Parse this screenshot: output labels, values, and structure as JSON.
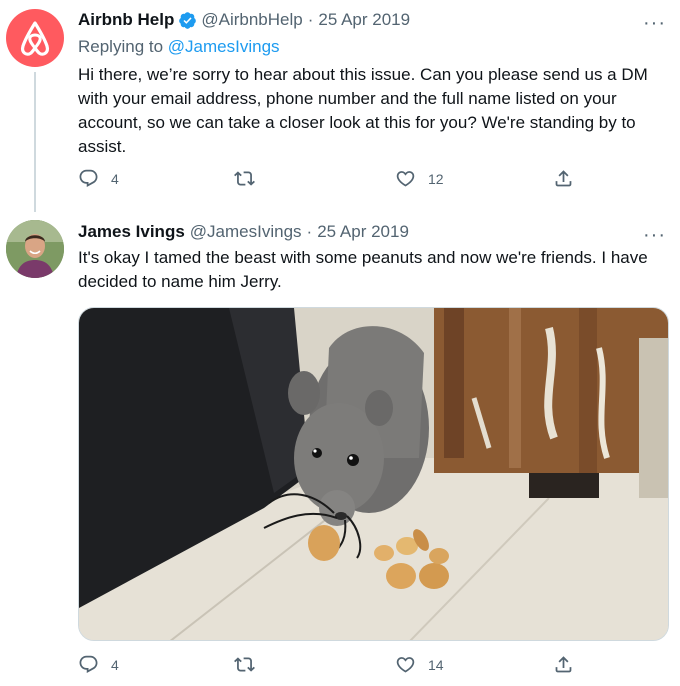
{
  "tweets": [
    {
      "name": "Airbnb Help",
      "handle": "@AirbnbHelp",
      "separator": "·",
      "date": "25 Apr 2019",
      "more": "···",
      "replying_label": "Replying to",
      "replying_handle": "@JamesIvings",
      "text": "Hi there, we’re sorry to hear about this issue. Can you please send us a DM with your email address, phone number and the full name listed on your account, so we can take a closer look at this for you? We're standing by to assist.",
      "replies": "4",
      "retweets": "",
      "likes": "12",
      "verified": true,
      "brand_color": "#ff5a5f"
    },
    {
      "name": "James Ivings",
      "handle": "@JamesIvings",
      "separator": "·",
      "date": "25 Apr 2019",
      "more": "···",
      "text": "It's okay I tamed the beast with some peanuts and now we're friends. I have decided to name him Jerry.",
      "replies": "4",
      "retweets": "",
      "likes": "14"
    }
  ],
  "icons": [
    "airbnb-logo-icon",
    "verified-badge-icon",
    "reply-icon",
    "retweet-icon",
    "like-icon",
    "share-icon",
    "more-icon"
  ],
  "colors": {
    "accent": "#1d9bf0",
    "muted": "#536471",
    "text": "#0f1419"
  }
}
